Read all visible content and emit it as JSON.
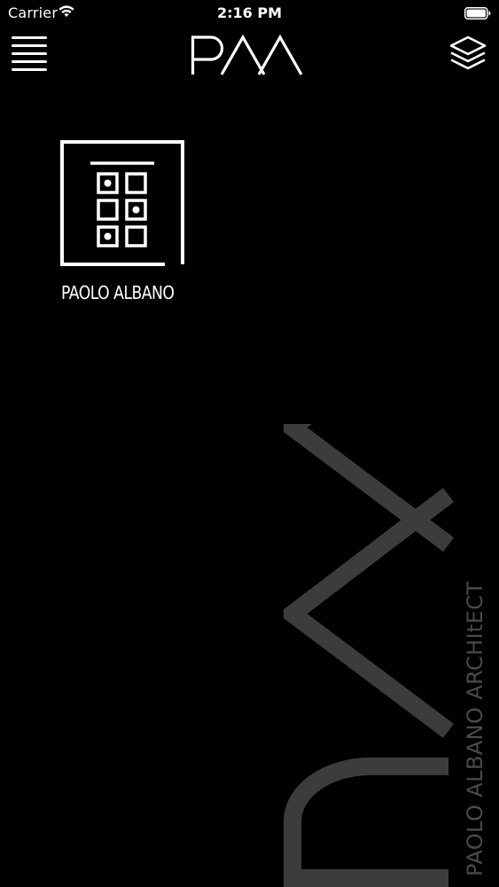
{
  "status_bar": {
    "carrier": "Carrier",
    "time": "2:16 PM",
    "wifi_icon": "wifi-icon",
    "battery_icon": "battery-icon"
  },
  "nav_bar": {
    "menu_icon": "hamburger-menu-icon",
    "brand": "PAA",
    "layers_icon": "layers-icon"
  },
  "projects": [
    {
      "label": "PAOLO ALBANO",
      "icon": "building-facade-icon"
    }
  ],
  "watermark": {
    "logo": "PAA",
    "text": "PAOLO ALBANO ARCHItECT"
  },
  "colors": {
    "background": "#000000",
    "foreground": "#ffffff",
    "watermark": "#4a4a4a"
  }
}
